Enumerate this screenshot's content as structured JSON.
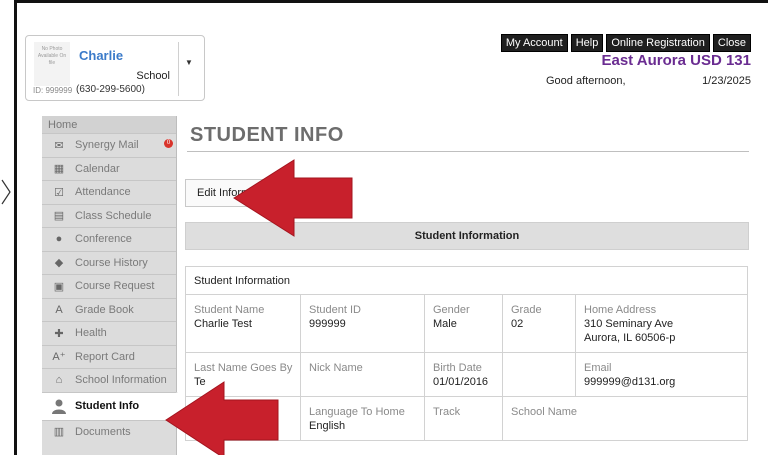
{
  "student_card": {
    "photo_text": "No Photo Available On file",
    "name": "Charlie",
    "school": "School",
    "id": "ID: 999999",
    "phone": "(630-299-5600)"
  },
  "top_buttons": [
    "My Account",
    "Help",
    "Online Registration",
    "Close"
  ],
  "district": "East Aurora USD 131",
  "greeting": "Good afternoon,",
  "date": "1/23/2025",
  "sidebar": {
    "home": "Home",
    "items": [
      {
        "label": "Synergy Mail",
        "icon": "mail-icon",
        "badge": "0"
      },
      {
        "label": "Calendar",
        "icon": "calendar-icon"
      },
      {
        "label": "Attendance",
        "icon": "checkbox-icon"
      },
      {
        "label": "Class Schedule",
        "icon": "schedule-icon"
      },
      {
        "label": "Conference",
        "icon": "conference-icon"
      },
      {
        "label": "Course History",
        "icon": "course-history-icon"
      },
      {
        "label": "Course Request",
        "icon": "course-request-icon"
      },
      {
        "label": "Grade Book",
        "icon": "gradebook-icon"
      },
      {
        "label": "Health",
        "icon": "health-icon"
      },
      {
        "label": "Report Card",
        "icon": "report-card-icon"
      },
      {
        "label": "School Information",
        "icon": "school-icon"
      },
      {
        "label": "Student Info",
        "icon": "student-icon",
        "active": true
      },
      {
        "label": "Documents",
        "icon": "documents-icon"
      }
    ]
  },
  "main": {
    "title": "STUDENT INFO",
    "edit_button": "Edit Informa",
    "section_title": "Student Information",
    "table_header": "Student Information",
    "rows": [
      [
        {
          "label": "Student Name",
          "value": "Charlie Test"
        },
        {
          "label": "Student ID",
          "value": "999999"
        },
        {
          "label": "Gender",
          "value": "Male"
        },
        {
          "label": "Grade",
          "value": "02"
        },
        {
          "label": "Home Address",
          "value": "310 Seminary Ave",
          "value2": "Aurora, IL 60506-p"
        }
      ],
      [
        {
          "label": "Last Name Goes By",
          "value": "Te"
        },
        {
          "label": "Nick Name",
          "value": ""
        },
        {
          "label": "Birth Date",
          "value": "01/01/2016"
        },
        {
          "label": "",
          "value": ""
        },
        {
          "label": "Email",
          "value": "999999@d131.org"
        }
      ],
      [
        {
          "label": "",
          "value": ""
        },
        {
          "label": "Language To Home",
          "value": "English"
        },
        {
          "label": "Track",
          "value": ""
        },
        {
          "label": "School Name",
          "value": ""
        }
      ]
    ]
  },
  "colors": {
    "arrow": "#c8202c",
    "district": "#6a2c91",
    "name": "#3a7ac9"
  }
}
